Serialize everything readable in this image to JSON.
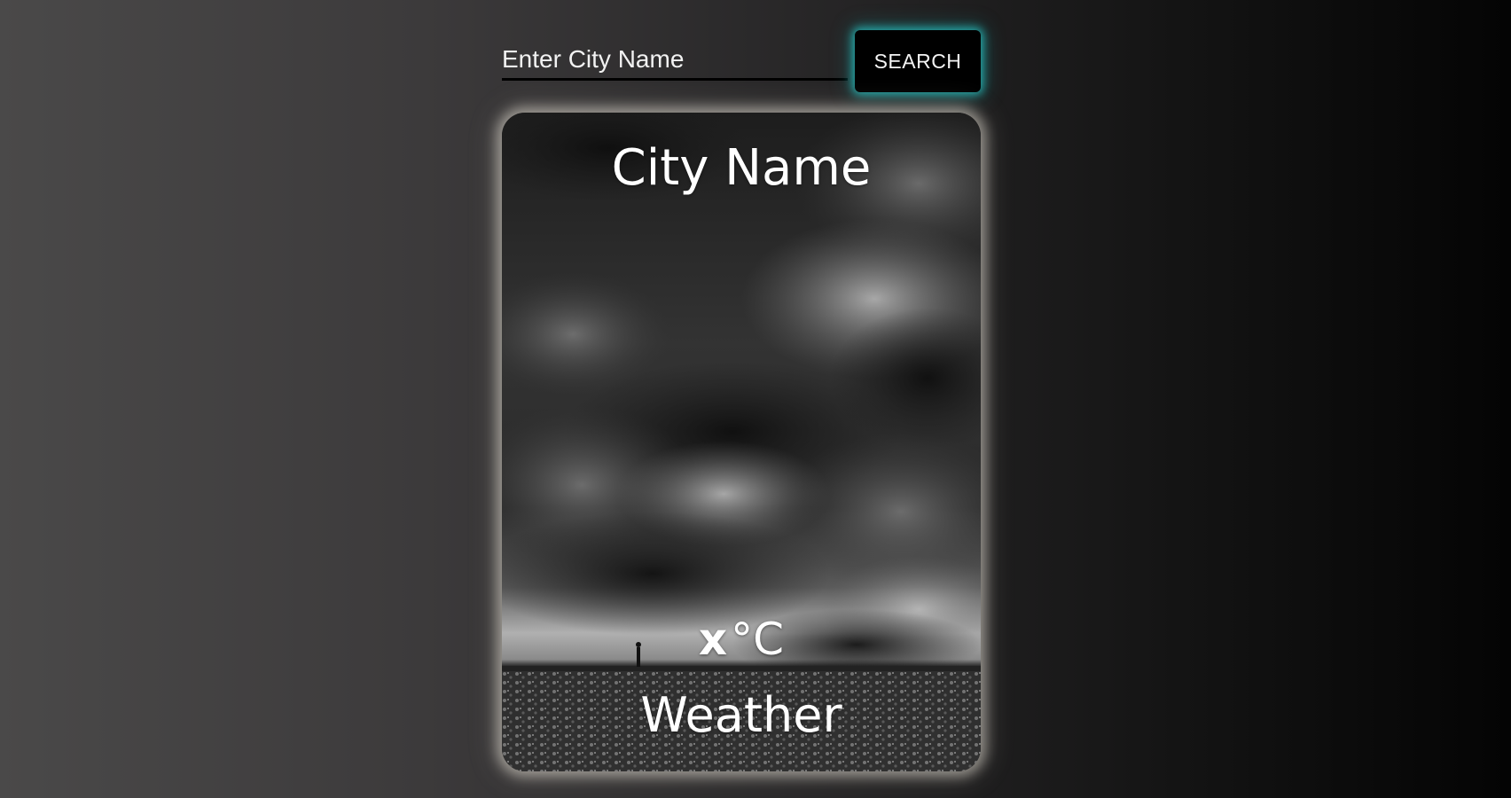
{
  "search": {
    "placeholder": "Enter City Name",
    "value": "",
    "button_label": "SEARCH"
  },
  "card": {
    "city_name": "City Name",
    "temperature": "x",
    "temperature_unit": "°C",
    "description": "Weather",
    "background_image": "stormy-clouds-over-meadow"
  },
  "colors": {
    "button_bg": "#000000",
    "button_glow": "#28c8c8",
    "card_glow": "#e1dcd2",
    "text": "#ffffff"
  }
}
